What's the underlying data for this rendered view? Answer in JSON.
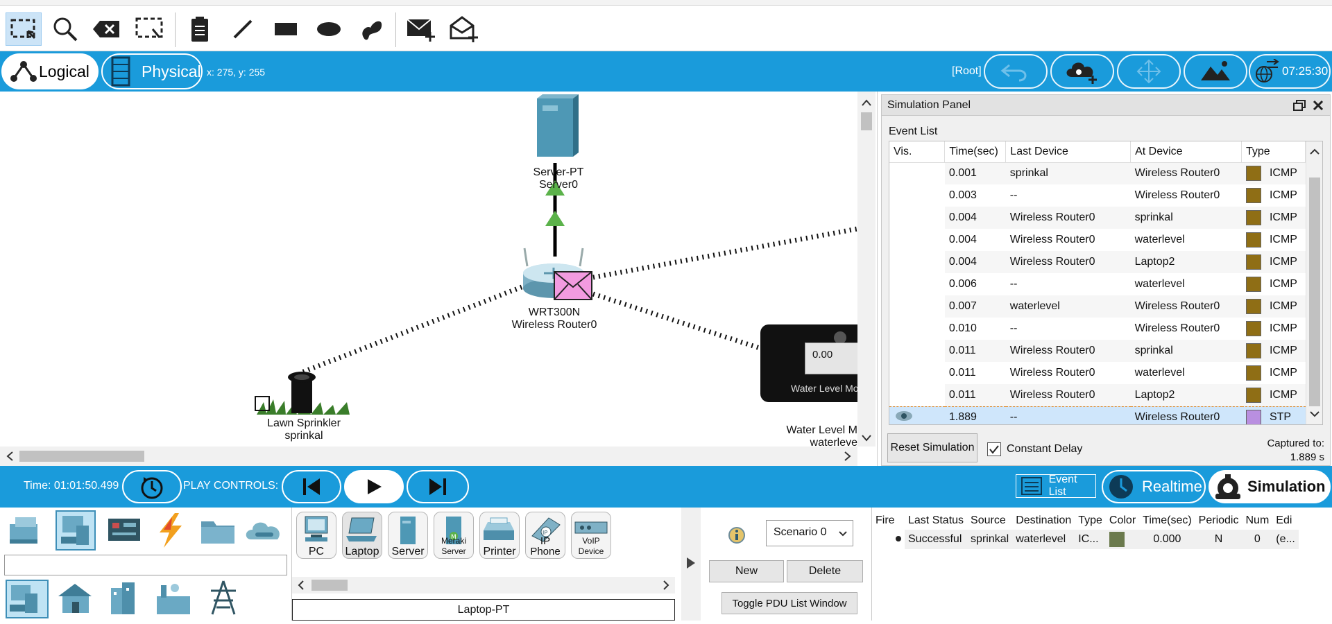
{
  "toolbar": {
    "tools": [
      "select",
      "inspect",
      "delete",
      "resize",
      "place-note",
      "draw-line",
      "draw-rectangle",
      "draw-ellipse",
      "freeform",
      "add-simple-pdu",
      "add-complex-pdu"
    ]
  },
  "topbar": {
    "logical_label": "Logical",
    "physical_label": "Physical",
    "coords": "x: 275, y: 255",
    "root_label": "[Root]",
    "clock": "07:25:30"
  },
  "workspace": {
    "server_model": "Server-PT",
    "server_name": "Server0",
    "router_model": "WRT300N",
    "router_name": "Wireless Router0",
    "sprinkler_model": "Lawn Sprinkler",
    "sprinkler_name": "sprinkal",
    "water_model": "Water Level M",
    "water_name": "waterleve",
    "water_display": "0.00",
    "water_screen_label": "Water Level Mo"
  },
  "simulation_panel": {
    "title": "Simulation Panel",
    "event_list_label": "Event List",
    "columns": [
      "Vis.",
      "Time(sec)",
      "Last Device",
      "At Device",
      "Type"
    ],
    "events": [
      {
        "time": "0.001",
        "last": "sprinkal",
        "at": "Wireless Router0",
        "type": "ICMP",
        "color": "#8f6e15"
      },
      {
        "time": "0.003",
        "last": "--",
        "at": "Wireless Router0",
        "type": "ICMP",
        "color": "#8f6e15"
      },
      {
        "time": "0.004",
        "last": "Wireless Router0",
        "at": "sprinkal",
        "type": "ICMP",
        "color": "#8f6e15"
      },
      {
        "time": "0.004",
        "last": "Wireless Router0",
        "at": "waterlevel",
        "type": "ICMP",
        "color": "#8f6e15"
      },
      {
        "time": "0.004",
        "last": "Wireless Router0",
        "at": "Laptop2",
        "type": "ICMP",
        "color": "#8f6e15"
      },
      {
        "time": "0.006",
        "last": "--",
        "at": "waterlevel",
        "type": "ICMP",
        "color": "#8f6e15"
      },
      {
        "time": "0.007",
        "last": "waterlevel",
        "at": "Wireless Router0",
        "type": "ICMP",
        "color": "#8f6e15"
      },
      {
        "time": "0.010",
        "last": "--",
        "at": "Wireless Router0",
        "type": "ICMP",
        "color": "#8f6e15"
      },
      {
        "time": "0.011",
        "last": "Wireless Router0",
        "at": "sprinkal",
        "type": "ICMP",
        "color": "#8f6e15"
      },
      {
        "time": "0.011",
        "last": "Wireless Router0",
        "at": "waterlevel",
        "type": "ICMP",
        "color": "#8f6e15"
      },
      {
        "time": "0.011",
        "last": "Wireless Router0",
        "at": "Laptop2",
        "type": "ICMP",
        "color": "#8f6e15"
      },
      {
        "time": "1.889",
        "last": "--",
        "at": "Wireless Router0",
        "type": "STP",
        "color": "#b98fe0"
      }
    ],
    "reset_label": "Reset Simulation",
    "constant_delay_label": "Constant Delay",
    "captured_label": "Captured to:",
    "captured_value": "1.889 s"
  },
  "playbar": {
    "time": "Time: 01:01:50.499",
    "play_controls_label": "PLAY CONTROLS:",
    "event_list_btn": "Event List",
    "realtime_label": "Realtime",
    "simulation_label": "Simulation"
  },
  "bottom": {
    "devices": [
      "PC",
      "Laptop",
      "Server",
      "Meraki Server",
      "Printer",
      "IP Phone",
      "VoIP Device"
    ],
    "selected_device": "Laptop-PT",
    "scenario": "Scenario 0",
    "new_label": "New",
    "delete_label": "Delete",
    "toggle_label": "Toggle PDU List Window",
    "pdu_columns": [
      "Fire",
      "Last Status",
      "Source",
      "Destination",
      "Type",
      "Color",
      "Time(sec)",
      "Periodic",
      "Num",
      "Edi"
    ],
    "pdu_row": {
      "status": "Successful",
      "source": "sprinkal",
      "destination": "waterlevel",
      "type": "IC...",
      "color": "#6b7a4d",
      "time": "0.000",
      "periodic": "N",
      "num": "0",
      "edit": "(e..."
    }
  }
}
